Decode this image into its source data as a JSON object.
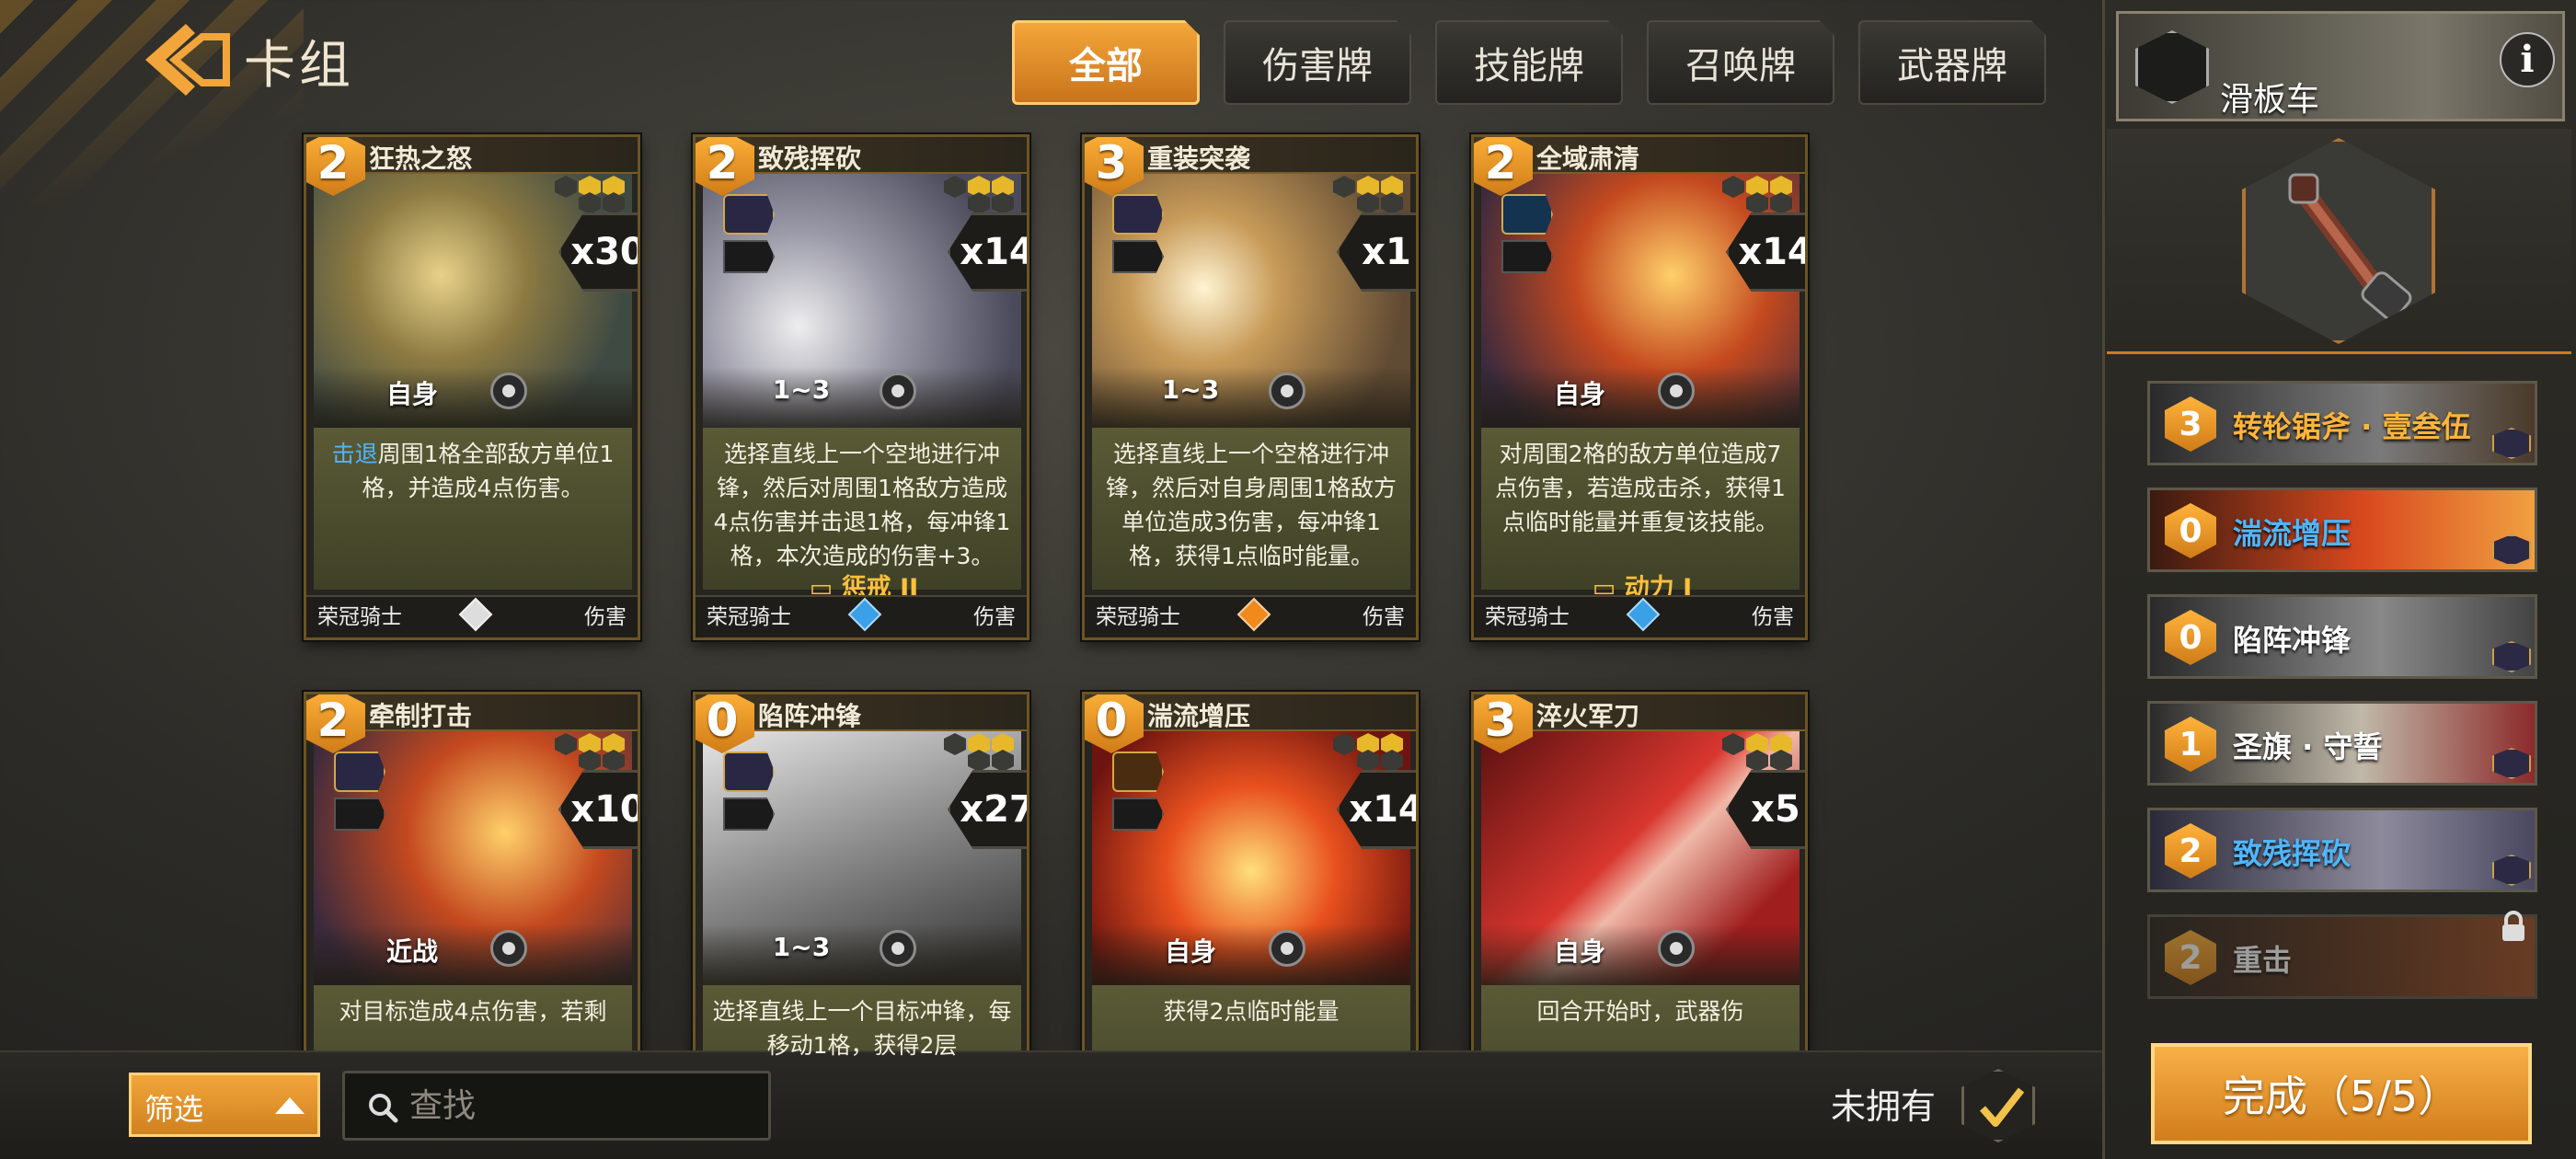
{
  "header": {
    "title": "卡组",
    "tabs": [
      {
        "label": "全部",
        "active": true
      },
      {
        "label": "伤害牌",
        "active": false
      },
      {
        "label": "技能牌",
        "active": false
      },
      {
        "label": "召唤牌",
        "active": false
      },
      {
        "label": "武器牌",
        "active": false
      }
    ]
  },
  "cards": [
    {
      "cost": "2",
      "name": "狂热之怒",
      "count": "x30",
      "target": "自身",
      "desc_kw": "击退",
      "desc": "周围1格全部敌方单位1格，并造成4点伤害。",
      "trait": "",
      "faction": "荣冠骑士",
      "type": "伤害",
      "gem_color": "#dddddd",
      "art": "art-gold"
    },
    {
      "cost": "2",
      "name": "致残挥砍",
      "count": "x14",
      "target": "1~3",
      "desc_kw": "",
      "desc": "选择直线上一个空地进行冲锋，然后对周围1格敌方造成4点伤害并击退1格，每冲锋1格，本次造成的伤害+3。",
      "trait": "惩戒 II",
      "faction": "荣冠骑士",
      "type": "伤害",
      "gem_color": "#3aa0e8",
      "art": "art-grey"
    },
    {
      "cost": "3",
      "name": "重装突袭",
      "count": "x1",
      "target": "1~3",
      "desc_kw": "",
      "desc": "选择直线上一个空格进行冲锋，然后对自身周围1格敌方单位造成3伤害，每冲锋1格，获得1点临时能量。",
      "trait": "",
      "faction": "荣冠骑士",
      "type": "伤害",
      "gem_color": "#f08a1c",
      "art": "art-bronze"
    },
    {
      "cost": "2",
      "name": "全域肃清",
      "count": "x14",
      "target": "自身",
      "desc_kw": "",
      "desc": "对周围2格的敌方单位造成7点伤害，若造成击杀，获得1点临时能量并重复该技能。",
      "trait": "动力 I",
      "faction": "荣冠骑士",
      "type": "伤害",
      "gem_color": "#3aa0e8",
      "art": "art-fire"
    },
    {
      "cost": "2",
      "name": "牵制打击",
      "count": "x10",
      "target": "近战",
      "desc_kw": "",
      "desc": "对目标造成4点伤害，若剩",
      "trait": "",
      "faction": "",
      "type": "",
      "gem_color": "",
      "art": "art-fire"
    },
    {
      "cost": "0",
      "name": "陷阵冲锋",
      "count": "x27",
      "target": "1~3",
      "desc_kw": "",
      "desc": "选择直线上一个目标冲锋，每移动1格，获得2层",
      "trait": "",
      "faction": "",
      "type": "",
      "gem_color": "",
      "art": "art-steel"
    },
    {
      "cost": "0",
      "name": "湍流增压",
      "count": "x14",
      "target": "自身",
      "desc_kw": "",
      "desc": "获得2点临时能量",
      "trait": "",
      "faction": "",
      "type": "",
      "gem_color": "",
      "art": "art-red"
    },
    {
      "cost": "3",
      "name": "淬火军刀",
      "count": "x5",
      "target": "自身",
      "desc_kw": "",
      "desc": "回合开始时，武器伤",
      "trait": "",
      "faction": "",
      "type": "",
      "gem_color": "",
      "art": "art-crimson"
    }
  ],
  "bottom": {
    "filter_label": "筛选",
    "search_placeholder": "查找",
    "unowned_label": "未拥有",
    "unowned_checked": true
  },
  "right_panel": {
    "vehicle_name": "滑板车",
    "info_glyph": "i",
    "deck": [
      {
        "cost": "3",
        "name": "转轮锯斧 · 壹叁伍",
        "name_color": "#ffb43c",
        "locked": false
      },
      {
        "cost": "0",
        "name": "湍流增压",
        "name_color": "#4fb6ff",
        "locked": false
      },
      {
        "cost": "0",
        "name": "陷阵冲锋",
        "name_color": "#ffffff",
        "locked": false
      },
      {
        "cost": "1",
        "name": "圣旗 · 守誓",
        "name_color": "#ffffff",
        "locked": false
      },
      {
        "cost": "2",
        "name": "致残挥砍",
        "name_color": "#4fb6ff",
        "locked": false
      },
      {
        "cost": "2",
        "name": "重击",
        "name_color": "#ffffff",
        "locked": true
      }
    ],
    "done_label": "完成（5/5）"
  },
  "colors": {
    "accent": "#f2a53b",
    "keyword": "#4fb6ff",
    "trait": "#ffc03b"
  }
}
